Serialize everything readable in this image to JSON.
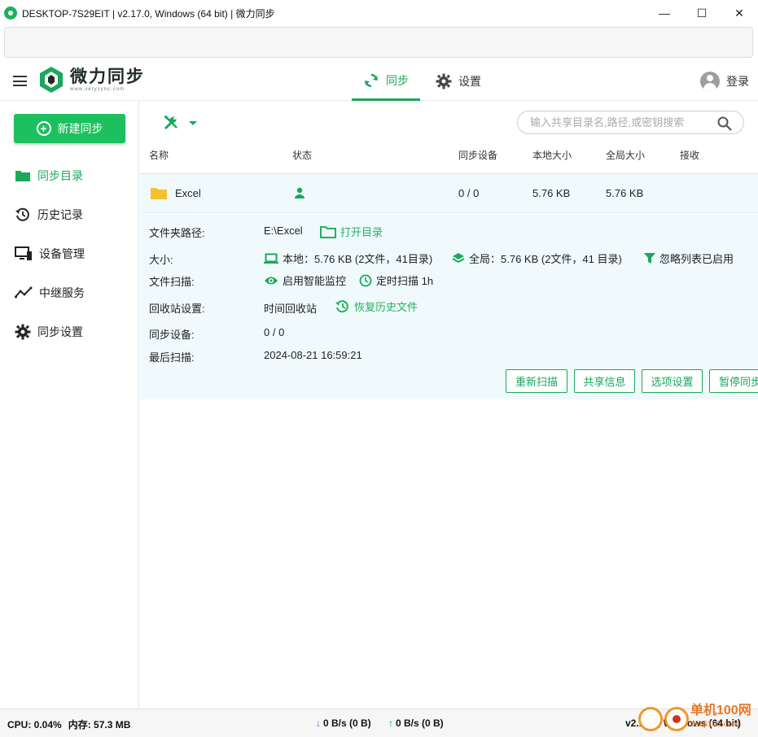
{
  "window": {
    "title": "DESKTOP-7S29EIT | v2.17.0, Windows (64 bit) | 微力同步",
    "minimize": "—",
    "maximize": "☐",
    "close": "✕"
  },
  "header": {
    "logo_name": "微力同步",
    "logo_sub": "www.verysync.com",
    "tab_sync": "同步",
    "tab_settings": "设置",
    "login": "登录"
  },
  "sidebar": {
    "new_sync": "新建同步",
    "items": [
      {
        "label": "同步目录",
        "icon": "folder-icon"
      },
      {
        "label": "历史记录",
        "icon": "history-icon"
      },
      {
        "label": "设备管理",
        "icon": "device-icon"
      },
      {
        "label": "中继服务",
        "icon": "relay-icon"
      },
      {
        "label": "同步设置",
        "icon": "gear-icon"
      }
    ]
  },
  "main": {
    "search_placeholder": "输入共享目录名,路径,或密钥搜索",
    "columns": [
      "名称",
      "状态",
      "同步设备",
      "本地大小",
      "全局大小",
      "接收"
    ],
    "row": {
      "name": "Excel",
      "devices": "0 / 0",
      "local_size": "5.76 KB",
      "global_size": "5.76 KB"
    },
    "details": {
      "path_label": "文件夹路径:",
      "path_value": "E:\\Excel",
      "open_dir": "打开目录",
      "size_label": "大小:",
      "local_size": "本地：5.76 KB (2文件，41目录)",
      "global_size": "全局：5.76 KB (2文件，41 目录)",
      "ignore": "忽略列表已启用",
      "scan_label": "文件扫描:",
      "smart_watch": "启用智能监控",
      "timed_scan": "定时扫描 1h",
      "recycle_label": "回收站设置:",
      "recycle_value": "时间回收站",
      "restore": "恢复历史文件",
      "devices_label": "同步设备:",
      "devices_value": "0 / 0",
      "last_scan_label": "最后扫描:",
      "last_scan_value": "2024-08-21 16:59:21"
    },
    "buttons": [
      "重新扫描",
      "共享信息",
      "选项设置",
      "暂停同步"
    ]
  },
  "status": {
    "cpu": "CPU: 0.04%",
    "mem": "内存: 57.3 MB",
    "down": "0 B/s (0 B)",
    "up": "0 B/s (0 B)",
    "version": "v2.17.0, Windows (64 bit)"
  },
  "watermark": {
    "text": "单机100网",
    "sub": "danji100.com"
  },
  "colors": {
    "accent": "#1aa85a",
    "button_green": "#1cc05f",
    "row_bg": "#f0fafd",
    "folder": "#f7c02f"
  }
}
